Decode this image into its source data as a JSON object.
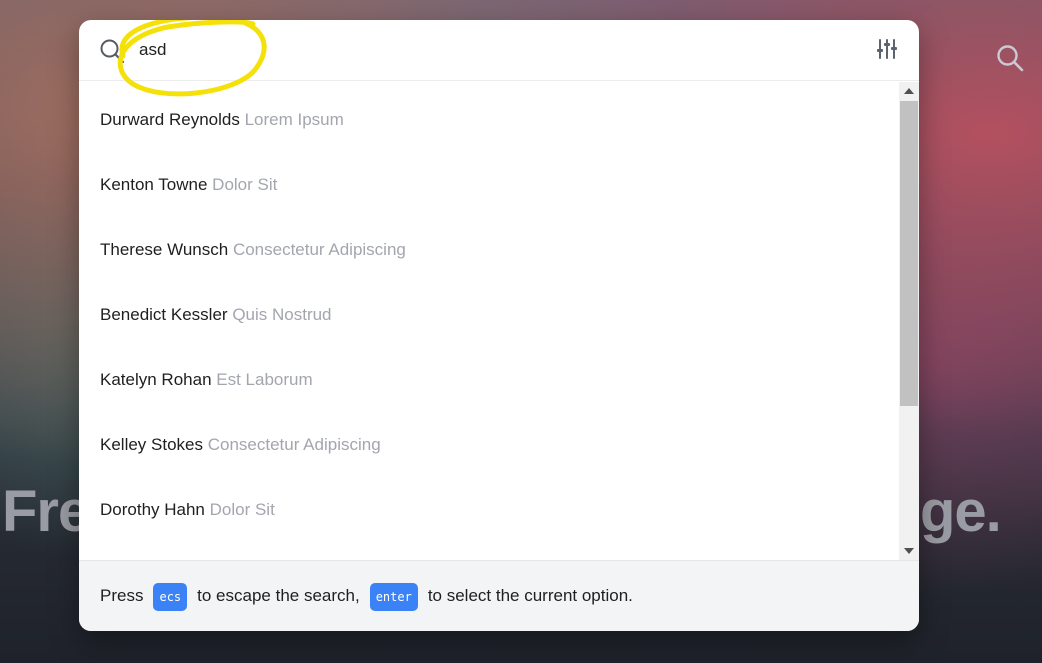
{
  "background": {
    "hero_text_left": "Fre",
    "hero_text_right": "ge."
  },
  "search": {
    "value": "asd",
    "placeholder": "",
    "icon": "search-icon",
    "filter_icon": "sliders-icon"
  },
  "results": [
    {
      "name": "Durward Reynolds",
      "description": "Lorem Ipsum"
    },
    {
      "name": "Kenton Towne",
      "description": "Dolor Sit"
    },
    {
      "name": "Therese Wunsch",
      "description": "Consectetur Adipiscing"
    },
    {
      "name": "Benedict Kessler",
      "description": "Quis Nostrud"
    },
    {
      "name": "Katelyn Rohan",
      "description": "Est Laborum"
    },
    {
      "name": "Kelley Stokes",
      "description": "Consectetur Adipiscing"
    },
    {
      "name": "Dorothy Hahn",
      "description": "Dolor Sit"
    }
  ],
  "footer": {
    "press": "Press",
    "escape_key": "ecs",
    "escape_text": "to escape the search,",
    "enter_key": "enter",
    "enter_text": "to select the current option."
  },
  "colors": {
    "accent": "#3b82f6",
    "highlight": "#f5e10a",
    "description_text": "#a3a6ad"
  }
}
